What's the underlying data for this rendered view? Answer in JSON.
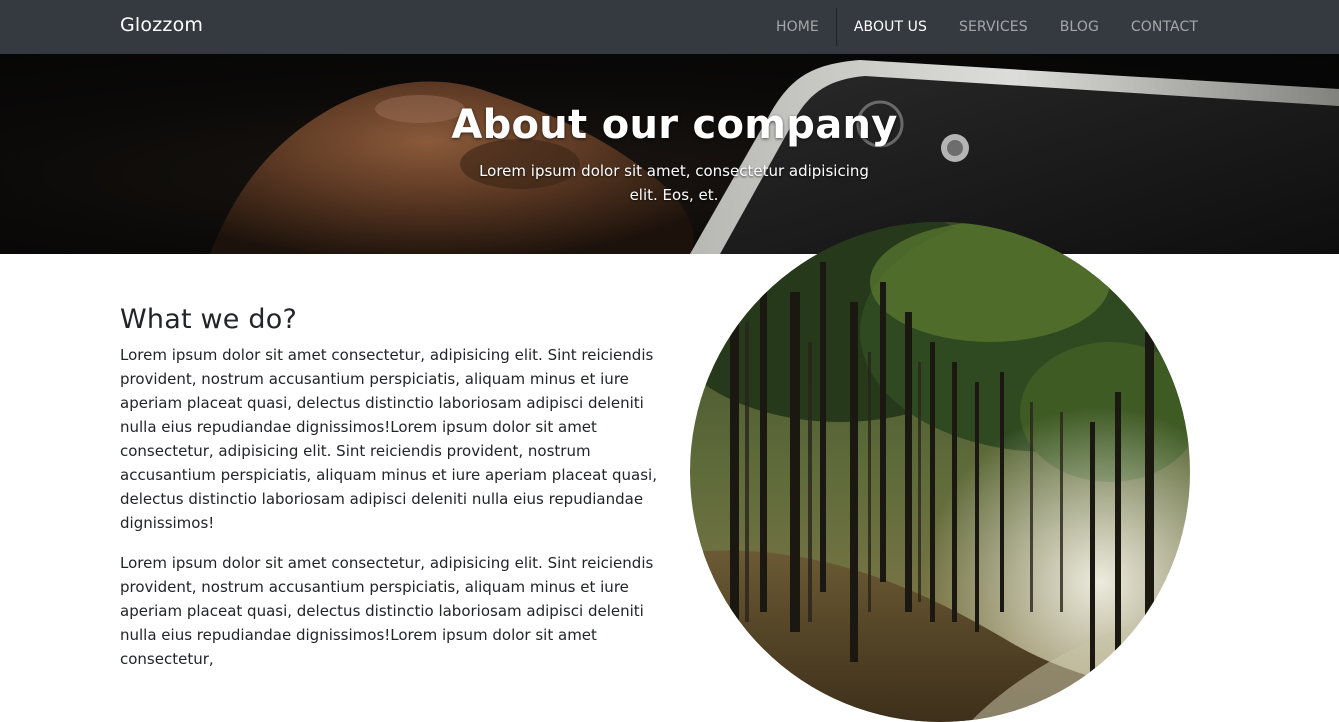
{
  "navbar": {
    "brand": "Glozzom",
    "items": [
      {
        "label": "HOME",
        "active": false
      },
      {
        "label": "ABOUT US",
        "active": true
      },
      {
        "label": "SERVICES",
        "active": false
      },
      {
        "label": "BLOG",
        "active": false
      },
      {
        "label": "CONTACT",
        "active": false
      }
    ]
  },
  "hero": {
    "title": "About our company",
    "subtitle": "Lorem ipsum dolor sit amet, consectetur adipisicing elit. Eos, et."
  },
  "section": {
    "heading": "What we do?",
    "paragraphs": [
      "Lorem ipsum dolor sit amet consectetur, adipisicing elit. Sint reiciendis provident, nostrum accusantium perspiciatis, aliquam minus et iure aperiam placeat quasi, delectus distinctio laboriosam adipisci deleniti nulla eius repudiandae dignissimos!Lorem ipsum dolor sit amet consectetur, adipisicing elit. Sint reiciendis provident, nostrum accusantium perspiciatis, aliquam minus et iure aperiam placeat quasi, delectus distinctio laboriosam adipisci deleniti nulla eius repudiandae dignissimos!",
      "Lorem ipsum dolor sit amet consectetur, adipisicing elit. Sint reiciendis provident, nostrum accusantium perspiciatis, aliquam minus et iure aperiam placeat quasi, delectus distinctio laboriosam adipisci deleniti nulla eius repudiandae dignissimos!Lorem ipsum dolor sit amet consectetur,"
    ]
  },
  "colors": {
    "navbar_bg": "#343a40",
    "nav_link": "#9a9da0",
    "nav_active": "#ffffff",
    "text": "#212529"
  },
  "images": {
    "hero": "dark-photo-rock-and-phone",
    "circle": "forest-path-photo"
  }
}
